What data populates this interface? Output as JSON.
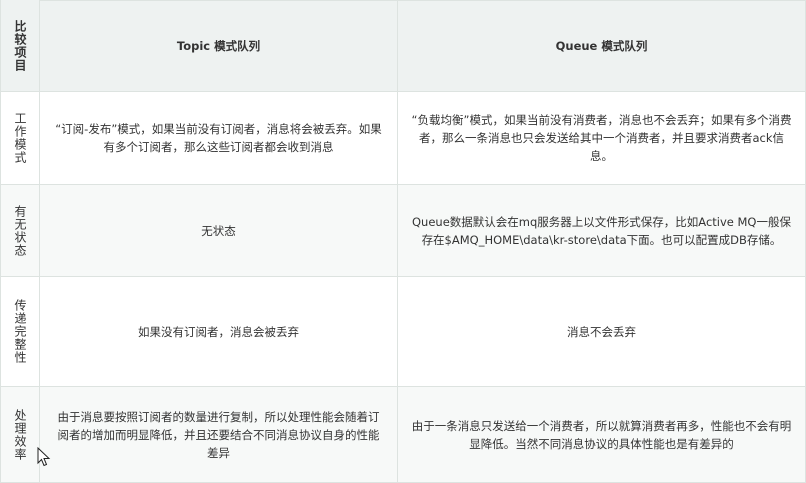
{
  "table": {
    "corner_label": "比较项目",
    "columns": [
      "Topic 模式队列",
      "Queue 模式队列"
    ],
    "rows": [
      {
        "label": "工作模式",
        "topic": "“订阅-发布”模式，如果当前没有订阅者，消息将会被丢弃。如果有多个订阅者，那么这些订阅者都会收到消息",
        "queue": "“负载均衡”模式，如果当前没有消费者，消息也不会丢弃；如果有多个消费者，那么一条消息也只会发送给其中一个消费者，并且要求消费者ack信息。"
      },
      {
        "label": "有无状态",
        "topic": "无状态",
        "queue": "Queue数据默认会在mq服务器上以文件形式保存，比如Active MQ一般保存在$AMQ_HOME\\data\\kr-store\\data下面。也可以配置成DB存储。"
      },
      {
        "label": "传递完整性",
        "topic": "如果没有订阅者，消息会被丢弃",
        "queue": "消息不会丢弃"
      },
      {
        "label": "处理效率",
        "topic": "由于消息要按照订阅者的数量进行复制，所以处理性能会随着订阅者的增加而明显降低，并且还要结合不同消息协议自身的性能差异",
        "queue": "由于一条消息只发送给一个消费者，所以就算消费者再多，性能也不会有明显降低。当然不同消息协议的具体性能也是有差异的"
      }
    ]
  }
}
